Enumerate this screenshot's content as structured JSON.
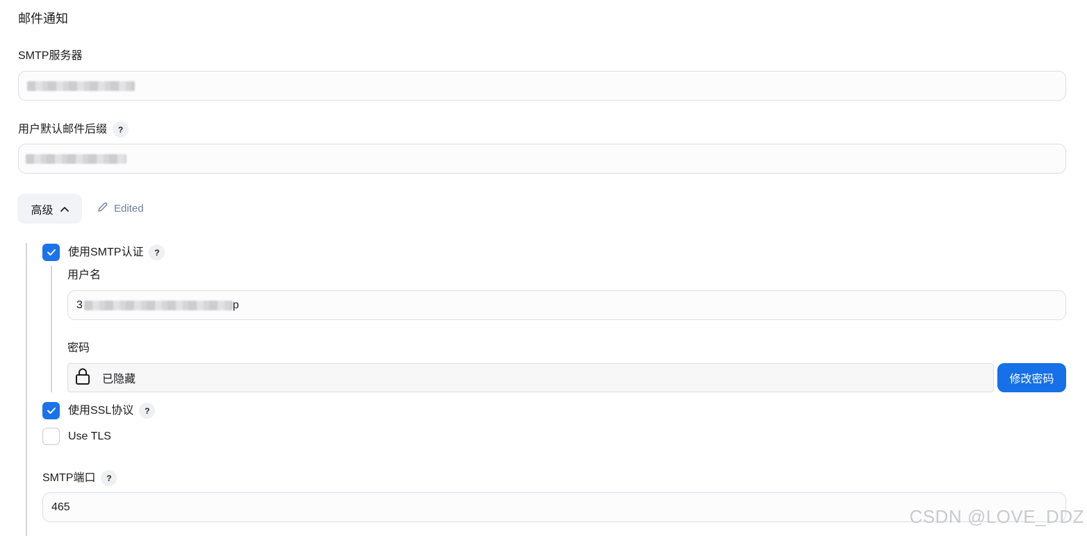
{
  "section": {
    "title": "邮件通知"
  },
  "smtp_server": {
    "label": "SMTP服务器"
  },
  "default_suffix": {
    "label": "用户默认邮件后缀",
    "help": "?"
  },
  "advanced": {
    "label": "高级",
    "edited": "Edited"
  },
  "smtp_auth": {
    "label": "使用SMTP认证",
    "help": "?",
    "checked": true
  },
  "username": {
    "label": "用户名",
    "value_prefix": "3",
    "value_suffix": "p"
  },
  "password": {
    "label": "密码",
    "status": "已隐藏",
    "change_button": "修改密码"
  },
  "use_ssl": {
    "label": "使用SSL协议",
    "help": "?",
    "checked": true
  },
  "use_tls": {
    "label": "Use TLS",
    "checked": false
  },
  "smtp_port": {
    "label": "SMTP端口",
    "help": "?",
    "value": "465"
  },
  "watermark": "CSDN @LOVE_DDZ",
  "colors": {
    "accent": "#1670e8",
    "edited": "#6c7ea0"
  }
}
